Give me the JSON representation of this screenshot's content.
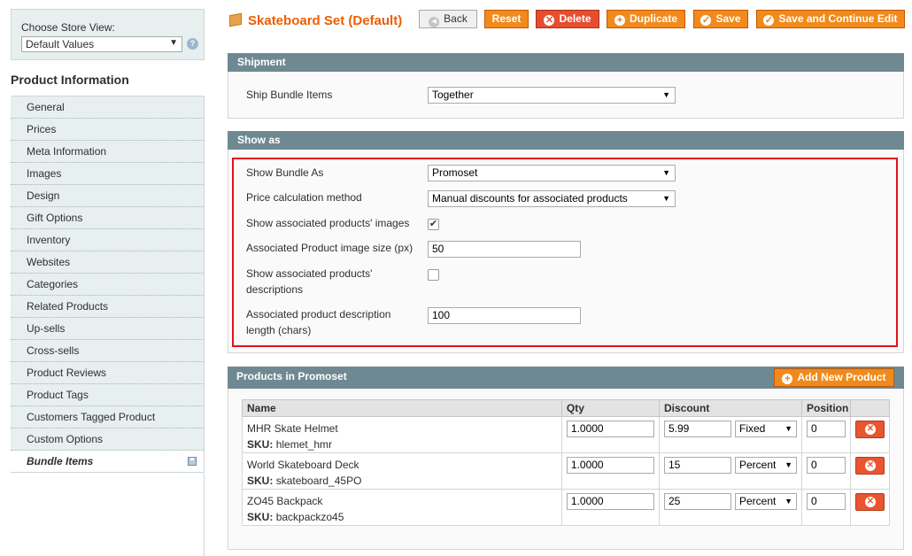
{
  "store_view": {
    "label": "Choose Store View:",
    "value": "Default Values",
    "help_icon": "?"
  },
  "sidebar": {
    "title": "Product Information",
    "items": [
      {
        "label": "General"
      },
      {
        "label": "Prices"
      },
      {
        "label": "Meta Information"
      },
      {
        "label": "Images"
      },
      {
        "label": "Design"
      },
      {
        "label": "Gift Options"
      },
      {
        "label": "Inventory"
      },
      {
        "label": "Websites"
      },
      {
        "label": "Categories"
      },
      {
        "label": "Related Products"
      },
      {
        "label": "Up-sells"
      },
      {
        "label": "Cross-sells"
      },
      {
        "label": "Product Reviews"
      },
      {
        "label": "Product Tags"
      },
      {
        "label": "Customers Tagged Product"
      },
      {
        "label": "Custom Options"
      },
      {
        "label": "Bundle Items",
        "active": true
      }
    ]
  },
  "header": {
    "title": "Skateboard Set (Default)",
    "buttons": {
      "back": "Back",
      "reset": "Reset",
      "delete": "Delete",
      "duplicate": "Duplicate",
      "save": "Save",
      "save_continue": "Save and Continue Edit"
    }
  },
  "shipment": {
    "title": "Shipment",
    "ship_label": "Ship Bundle Items",
    "ship_value": "Together"
  },
  "show_as": {
    "title": "Show as",
    "show_bundle_label": "Show Bundle As",
    "show_bundle_value": "Promoset",
    "price_calc_label": "Price calculation method",
    "price_calc_value": "Manual discounts for associated products",
    "show_images_label": "Show associated products' images",
    "show_images_checked": true,
    "image_size_label": "Associated Product image size (px)",
    "image_size_value": "50",
    "show_desc_label_1": "Show associated products'",
    "show_desc_label_2": "descriptions",
    "show_desc_checked": false,
    "desc_length_label_1": "Associated product description",
    "desc_length_label_2": "length (chars)",
    "desc_length_value": "100"
  },
  "products": {
    "title": "Products in Promoset",
    "add_button": "Add New Product",
    "columns": {
      "name": "Name",
      "qty": "Qty",
      "discount": "Discount",
      "position": "Position"
    },
    "sku_label": "SKU:",
    "rows": [
      {
        "name": "MHR Skate Helmet",
        "sku": "hlemet_hmr",
        "qty": "1.0000",
        "discount": "5.99",
        "discount_type": "Fixed",
        "position": "0"
      },
      {
        "name": "World Skateboard Deck",
        "sku": "skateboard_45PO",
        "qty": "1.0000",
        "discount": "15",
        "discount_type": "Percent",
        "position": "0"
      },
      {
        "name": "ZO45 Backpack",
        "sku": "backpackzo45",
        "qty": "1.0000",
        "discount": "25",
        "discount_type": "Percent",
        "position": "0"
      }
    ]
  },
  "colors": {
    "accent": "#eb5e00",
    "button": "#f28a1b",
    "section_header": "#6f8992",
    "highlight": "#e2131b"
  }
}
